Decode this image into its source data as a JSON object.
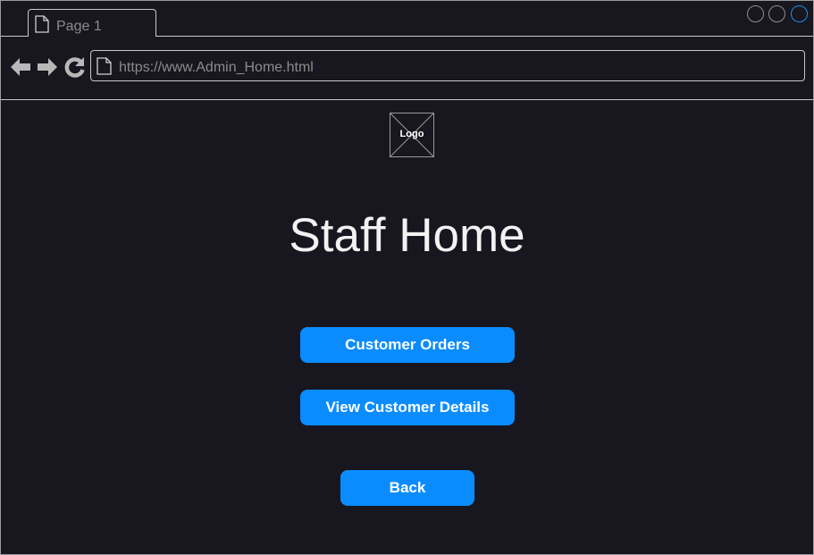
{
  "browser": {
    "tab_label": "Page 1",
    "url": "https://www.Admin_Home.html",
    "icons": {
      "tab": "page-icon",
      "back": "back-arrow-icon",
      "forward": "forward-arrow-icon",
      "reload": "reload-icon",
      "address": "page-icon"
    },
    "accent_color": "#1f8ef1"
  },
  "page": {
    "logo_label": "Logo",
    "title": "Staff Home",
    "buttons": {
      "customer_orders": "Customer Orders",
      "view_customer_details": "View Customer Details",
      "back": "Back"
    },
    "button_color": "#0a8cff",
    "background_color": "#18161f"
  }
}
